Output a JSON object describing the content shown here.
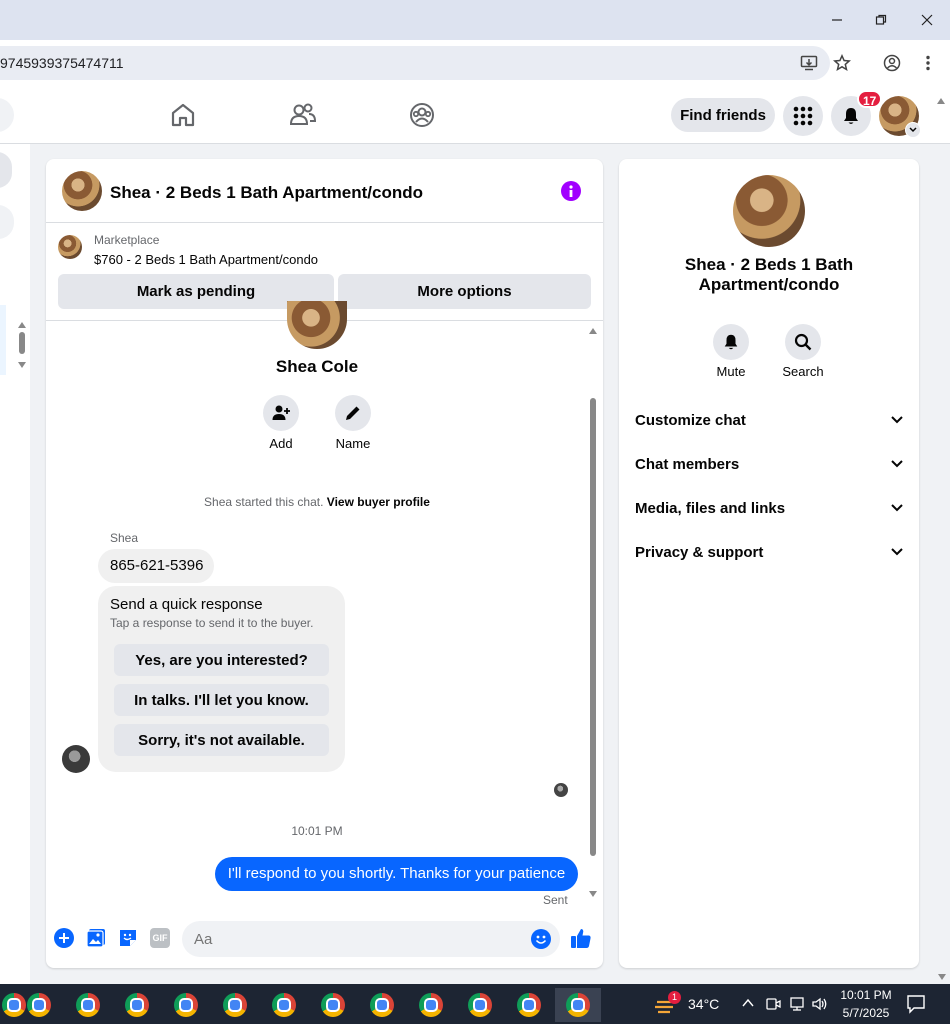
{
  "browser": {
    "url_fragment": "9745939375474711"
  },
  "fbnav": {
    "find_friends_label": "Find friends",
    "notification_count": "17"
  },
  "chat": {
    "header_title": "Shea · 2 Beds 1 Bath Apartment/condo",
    "marketplace_label": "Marketplace",
    "listing": "$760 - 2 Beds 1 Bath Apartment/condo",
    "mark_pending_label": "Mark as pending",
    "more_options_label": "More options",
    "contact_name": "Shea Cole",
    "add_label": "Add",
    "name_label": "Name",
    "started_text": "Shea started this chat.",
    "view_profile_link": "View buyer profile",
    "sender_name": "Shea",
    "phone_message": "865-621-5396",
    "quick_response_title": "Send a quick response",
    "quick_response_subtitle": "Tap a response to send it to the buyer.",
    "quick_responses": [
      "Yes, are you interested?",
      "In talks. I'll let you know.",
      "Sorry, it's not available."
    ],
    "timestamp": "10:01 PM",
    "sent_message": "I'll respond to you shortly. Thanks for your patience",
    "sent_status": "Sent",
    "input_placeholder": "Aa",
    "gif_label": "GIF"
  },
  "rightpanel": {
    "title": "Shea · 2 Beds 1 Bath Apartment/condo",
    "mute_label": "Mute",
    "search_label": "Search",
    "sections": [
      "Customize chat",
      "Chat members",
      "Media, files and links",
      "Privacy & support"
    ]
  },
  "taskbar": {
    "weather_temp": "34°C",
    "weather_badge": "1",
    "clock_time": "10:01 PM",
    "clock_date": "5/7/2025"
  },
  "colors": {
    "accent": "#0866ff",
    "notification_red": "#e41e3f",
    "info_purple": "#a100ff"
  }
}
